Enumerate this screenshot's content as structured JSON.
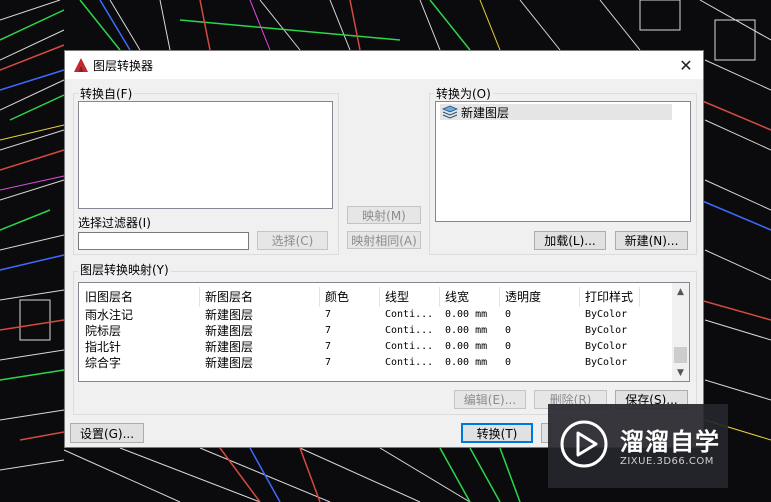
{
  "dialog": {
    "title": "图层转换器",
    "close_glyph": "✕"
  },
  "convert_from": {
    "label": "转换自(F)",
    "selection_filter_label": "选择过滤器(I)",
    "filter_value": "",
    "select_button": "选择(C)"
  },
  "middle": {
    "map_button": "映射(M)",
    "map_same_button": "映射相同(A)"
  },
  "convert_to": {
    "label": "转换为(O)",
    "items": [
      "新建图层"
    ],
    "load_button": "加载(L)...",
    "new_button": "新建(N)..."
  },
  "mapping": {
    "label": "图层转换映射(Y)",
    "columns": [
      "旧图层名",
      "新图层名",
      "颜色",
      "线型",
      "线宽",
      "透明度",
      "打印样式"
    ],
    "rows": [
      [
        "雨水注记",
        "新建图层",
        "7",
        "Conti...",
        "0.00 mm",
        "0",
        "ByColor"
      ],
      [
        "院标层",
        "新建图层",
        "7",
        "Conti...",
        "0.00 mm",
        "0",
        "ByColor"
      ],
      [
        "指北针",
        "新建图层",
        "7",
        "Conti...",
        "0.00 mm",
        "0",
        "ByColor"
      ],
      [
        "综合字",
        "新建图层",
        "7",
        "Conti...",
        "0.00 mm",
        "0",
        "ByColor"
      ]
    ],
    "edit_button": "编辑(E)...",
    "delete_button": "删除(R)",
    "save_button": "保存(S)..."
  },
  "footer": {
    "settings_button": "设置(G)...",
    "convert_button": "转换(T)"
  },
  "watermark": {
    "name": "溜溜自学",
    "url": "ZIXUE.3D66.COM"
  },
  "colors": {
    "accent": "#0078d7",
    "cad_background": "#0b0b0d",
    "autocad_logo": "#c4262e"
  }
}
